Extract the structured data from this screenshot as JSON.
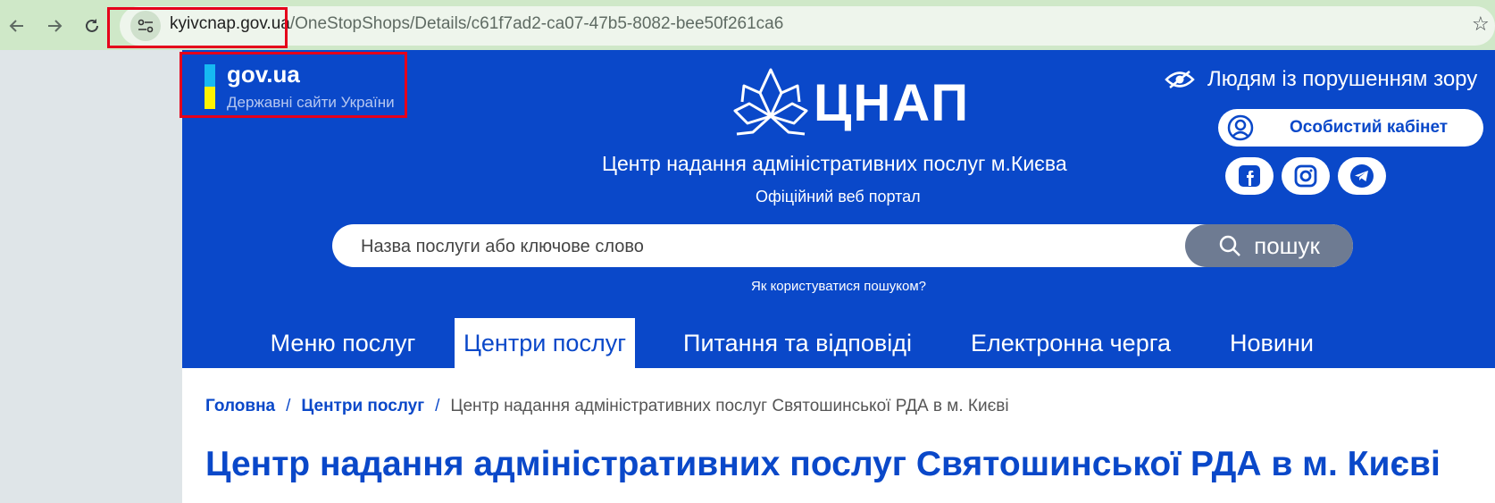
{
  "browser": {
    "url_host": "kyivcnap.gov.ua",
    "url_path": "/OneStopShops/Details/c61f7ad2-ca07-47b5-8082-bee50f261ca6"
  },
  "govua": {
    "title": "gov.ua",
    "subtitle": "Державні сайти України"
  },
  "header": {
    "logo_text": "ЦНАП",
    "title": "Центр надання адміністративних послуг м.Києва",
    "subtitle": "Офіційний веб портал",
    "vision_link": "Людям із порушенням зору",
    "cabinet_button": "Особистий кабінет"
  },
  "search": {
    "placeholder": "Назва послуги або ключове слово",
    "button": "пошук",
    "help": "Як користуватися пошуком?"
  },
  "menu": {
    "items": [
      {
        "label": "Меню послуг"
      },
      {
        "label": "Центри послуг",
        "active": true
      },
      {
        "label": "Питання та відповіді"
      },
      {
        "label": "Електронна черга"
      },
      {
        "label": "Новини"
      }
    ]
  },
  "breadcrumb": {
    "home": "Головна",
    "section": "Центри послуг",
    "current": "Центр надання адміністративних послуг Святошинської РДА в м. Києві"
  },
  "page": {
    "title": "Центр надання адміністративних послуг Святошинської РДА в м. Києві"
  },
  "colors": {
    "brand_blue": "#0a48c9",
    "highlight_red": "#e5001b",
    "flag_blue": "#16b9f2",
    "flag_yellow": "#fff200"
  },
  "icons": [
    "back-icon",
    "forward-icon",
    "reload-icon",
    "site-settings-icon",
    "star-icon",
    "cnap-logo",
    "eye-icon",
    "user-icon",
    "search-icon",
    "facebook-icon",
    "instagram-icon",
    "telegram-icon"
  ]
}
